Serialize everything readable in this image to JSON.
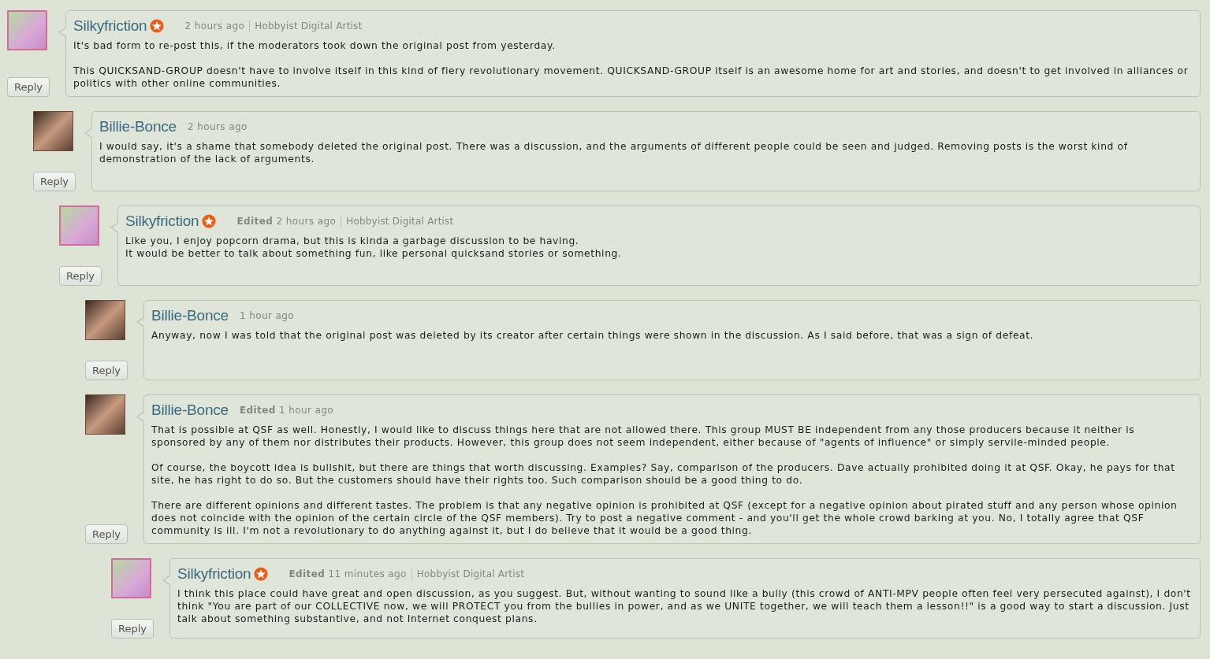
{
  "comments": [
    {
      "author": "Silkyfriction",
      "kind": "artist",
      "time": "2 hours ago",
      "role": "Hobbyist Digital Artist",
      "reply": "Reply",
      "paragraphs": [
        "It's bad form to re-post this, if the moderators took down the original post from yesterday.",
        "This QUICKSAND-GROUP doesn't have to involve itself in this kind of fiery revolutionary movement. QUICKSAND-GROUP itself is an awesome home for art and stories, and doesn't to get involved in alliances or politics with other online communities."
      ],
      "children": [
        {
          "author": "Billie-Bonce",
          "kind": "member",
          "time": "2 hours ago",
          "reply": "Reply",
          "paragraphs": [
            "I would say, it's a shame that somebody deleted the original post. There was a discussion, and the arguments of different people could be seen and judged. Removing posts is the worst kind of demonstration of the lack of arguments."
          ],
          "children": [
            {
              "author": "Silkyfriction",
              "kind": "artist",
              "edited_label": "Edited",
              "time": "2 hours ago",
              "role": "Hobbyist Digital Artist",
              "reply": "Reply",
              "paragraphs": [
                "Like you, I enjoy popcorn drama, but this is kinda a garbage discussion to be having.\nIt would be better to talk about something fun, like personal quicksand stories or something."
              ],
              "children": [
                {
                  "author": "Billie-Bonce",
                  "kind": "member",
                  "time": "1 hour ago",
                  "reply": "Reply",
                  "paragraphs": [
                    "Anyway, now I was told that the original post was deleted by its creator after certain things were shown in the discussion. As I said before, that was a sign of defeat."
                  ]
                },
                {
                  "author": "Billie-Bonce",
                  "kind": "member",
                  "edited_label": "Edited",
                  "time": "1 hour ago",
                  "reply": "Reply",
                  "paragraphs": [
                    "That is possible at QSF as well. Honestly, I would like to discuss things here that are not allowed there. This group MUST BE independent from any those producers because it neither is sponsored by any of them nor distributes their products. However, this group does not seem independent, either because of \"agents of influence\" or simply servile-minded people.",
                    "Of course, the boycott idea is bullshit, but there are things that worth discussing. Examples? Say, comparison of the producers. Dave actually prohibited doing it at QSF. Okay, he pays for that site, he has right to do so. But the customers should have their rights too. Such comparison should be a good thing to do.",
                    "There are different opinions and different tastes. The problem is that any negative opinion is prohibited at QSF (except for a negative opinion about pirated stuff and any person whose opinion does not coincide with the opinion of the certain circle of the QSF members). Try to post a negative comment - and you'll get the whole crowd barking at you. No, I totally agree that QSF community is ill. I'm not a revolutionary to do anything against it, but I do believe that it would be a good thing."
                  ],
                  "children": [
                    {
                      "author": "Silkyfriction",
                      "kind": "artist",
                      "edited_label": "Edited",
                      "time": "11 minutes ago",
                      "role": "Hobbyist Digital Artist",
                      "reply": "Reply",
                      "paragraphs": [
                        "I think this place could have great and open discussion, as you suggest. But, without wanting to sound like a bully (this crowd of ANTI-MPV people often feel very persecuted against), I don't think \"You are part of our COLLECTIVE now, we will PROTECT you from the bullies in power, and as we UNITE together, we will teach them a lesson!!\" is a good way to start a discussion. Just talk about something substantive, and not Internet conquest plans."
                      ]
                    }
                  ]
                }
              ]
            }
          ]
        }
      ]
    }
  ]
}
